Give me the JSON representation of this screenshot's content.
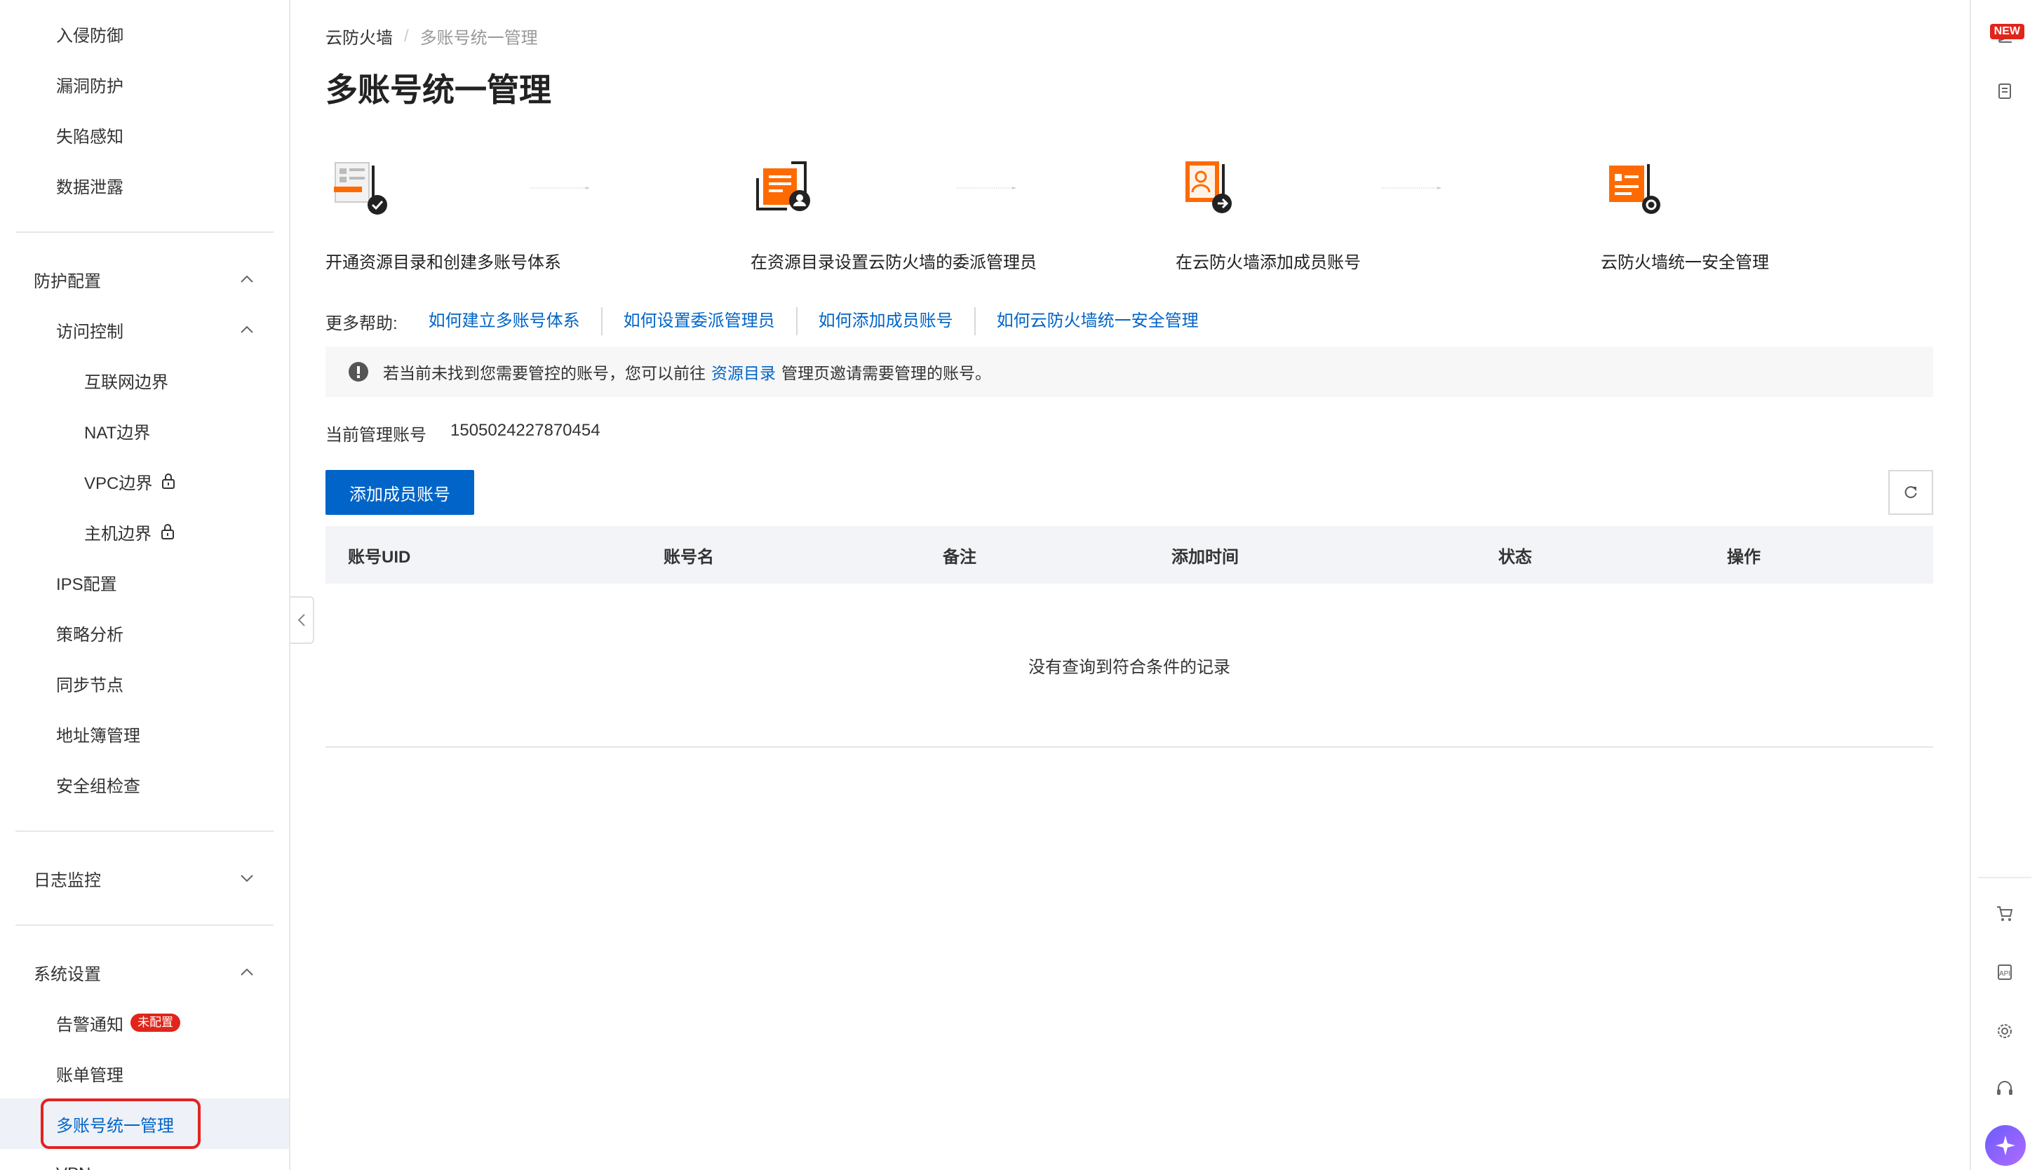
{
  "sidebar": {
    "top_items": [
      {
        "label": "入侵防御"
      },
      {
        "label": "漏洞防护"
      },
      {
        "label": "失陷感知"
      },
      {
        "label": "数据泄露"
      }
    ],
    "protect_config": {
      "label": "防护配置",
      "access_control": {
        "label": "访问控制",
        "items": [
          {
            "label": "互联网边界"
          },
          {
            "label": "NAT边界"
          },
          {
            "label": "VPC边界",
            "locked": true
          },
          {
            "label": "主机边界",
            "locked": true
          }
        ]
      },
      "items": [
        {
          "label": "IPS配置"
        },
        {
          "label": "策略分析"
        },
        {
          "label": "同步节点"
        },
        {
          "label": "地址簿管理"
        },
        {
          "label": "安全组检查"
        }
      ]
    },
    "log_monitor": {
      "label": "日志监控"
    },
    "system_settings": {
      "label": "系统设置",
      "items": [
        {
          "label": "告警通知",
          "badge": "未配置"
        },
        {
          "label": "账单管理"
        },
        {
          "label": "多账号统一管理",
          "active": true
        },
        {
          "label": "VPN"
        }
      ]
    }
  },
  "breadcrumb": {
    "root": "云防火墙",
    "current": "多账号统一管理"
  },
  "page_title": "多账号统一管理",
  "steps": [
    {
      "label": "开通资源目录和创建多账号体系",
      "icon": "directory-check-icon"
    },
    {
      "label": "在资源目录设置云防火墙的委派管理员",
      "icon": "delegate-admin-icon"
    },
    {
      "label": "在云防火墙添加成员账号",
      "icon": "add-member-icon"
    },
    {
      "label": "云防火墙统一安全管理",
      "icon": "unified-manage-icon"
    }
  ],
  "help": {
    "label": "更多帮助:",
    "links": [
      {
        "label": "如何建立多账号体系"
      },
      {
        "label": "如何设置委派管理员"
      },
      {
        "label": "如何添加成员账号"
      },
      {
        "label": "如何云防火墙统一安全管理"
      }
    ]
  },
  "notice": {
    "prefix": "若当前未找到您需要管控的账号，您可以前往",
    "link": "资源目录",
    "suffix": "管理页邀请需要管理的账号。"
  },
  "current_account": {
    "label": "当前管理账号",
    "value": "1505024227870454"
  },
  "add_button_label": "添加成员账号",
  "table": {
    "columns": [
      "账号UID",
      "账号名",
      "备注",
      "添加时间",
      "状态",
      "操作"
    ],
    "empty_text": "没有查询到符合条件的记录"
  },
  "right_bar": {
    "new_badge": "NEW"
  },
  "colors": {
    "primary": "#0064c8",
    "accent_orange": "#ff6a00",
    "badge_red": "#e1251b",
    "highlight_red": "#e3231f"
  }
}
